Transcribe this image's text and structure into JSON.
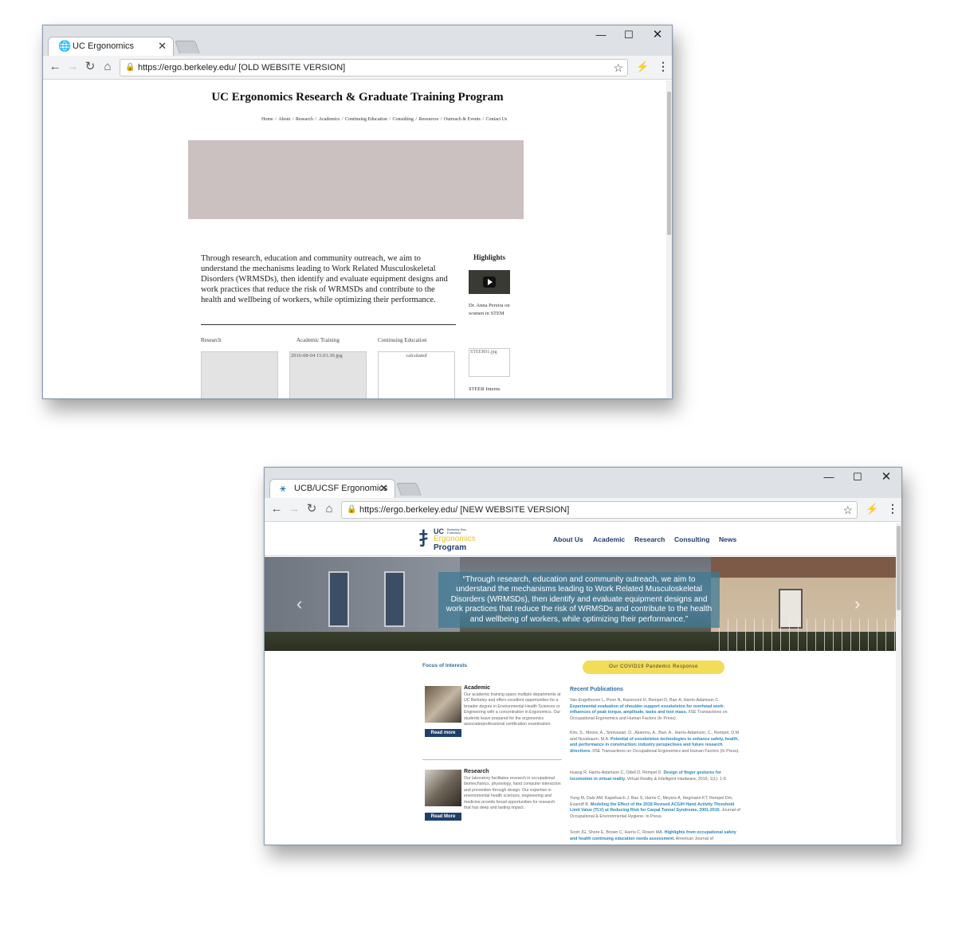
{
  "window_old": {
    "tab_title": "UC Ergonomics",
    "address": "https://ergo.berkeley.edu/ [OLD WEBSITE VERSION]",
    "page": {
      "title": "UC Ergonomics Research & Graduate Training Program",
      "nav": [
        "Home",
        "About",
        "Research",
        "Academics",
        "Continuing Education",
        "Consulting",
        "Resources",
        "Outreach & Events",
        "Contact Us"
      ],
      "intro": "Through research, education and community outreach, we aim to understand the mechanisms leading to Work Related Musculoskeletal Disorders (WRMSDs), then identify and evaluate equipment designs and work practices that reduce the risk of WRMSDs and contribute to the health and wellbeing of workers, while optimizing their performance.",
      "highlights_title": "Highlights",
      "highlight_caption": "Dr. Anna Pereira on women in STEM",
      "columns": [
        "Research",
        "Academic Training",
        "Continuing Education"
      ],
      "img_alt_2": "2016-08-04 15.03.39.jpg",
      "img_alt_3": "calculated",
      "steer_alt": "STEER01.jpg",
      "steer_caption": "STEER Interns"
    }
  },
  "window_new": {
    "tab_title": "UCB/UCSF Ergonomics",
    "address": "https://ergo.berkeley.edu/ [NEW WEBSITE VERSION]",
    "page": {
      "logo": {
        "uc": "UC",
        "sub": "Berkeley San Francisco",
        "line2": "Ergonomics",
        "line3": "Program"
      },
      "nav": [
        "About Us",
        "Academic",
        "Research",
        "Consulting",
        "News"
      ],
      "hero_quote": "“Through research, education and community outreach, we aim to understand the mechanisms leading to Work Related Musculoskeletal Disorders (WRMSDs), then identify and evaluate equipment designs and work practices that reduce the risk of WRMSDs and contribute to the health and wellbeing of workers, while optimizing their performance.”",
      "focus_label": "Focus of Interests",
      "covid_button": "Our COVID19 Pandemic Response",
      "cards": [
        {
          "title": "Academic",
          "body": "Our academic training spans multiple departments at UC Berkeley and offers excellent opportunities for a broader degree in Environmental Health Sciences or Engineering with a concentration in Ergonomics. Our students leave prepared for the ergonomics associate/professional certification examination.",
          "button": "Read more"
        },
        {
          "title": "Research",
          "body": "Our laboratory facilitates research in occupational biomechanics, physiology, hand computer interaction and prevention through design. Our expertise in environmental health sciences, engineering and medicine provide broad opportunities for research that has deep and lasting impact.",
          "button": "Read More"
        }
      ],
      "publications_title": "Recent Publications",
      "publications": [
        {
          "authors": "Van Engelhoven L, Poon N, Kazerooni H, Rempel D, Barr A, Harris-Adamson C.",
          "title": "Experimental evaluation of shoulder-support exoskeleton for overhead work: influences of peak torque, amplitude, tasks and tool mass.",
          "source": "IISE Transactions on Occupational Ergonomics and Human Factors (In Press)."
        },
        {
          "authors": "Kim, S., Moore, A., Srinivasan, D., Akanmu, A., Barr, A., Harris-Adamson, C., Rempel, D.M. and Nussbaum, M.A.",
          "title": "Potential of exoskeleton technologies to enhance safety, health, and performance in construction: industry perspectives and future research directions.",
          "source": "IISE Transactions on Occupational Ergonomics and Human Factors (In Press)."
        },
        {
          "authors": "Huang R, Harris-Adamson C, Odell D, Rempel D.",
          "title": "Design of finger gestures for locomotion in virtual reality.",
          "source": "Virtual Reality & Intelligent Hardware, 2019, 1(1): 1-9."
        },
        {
          "authors": "Yung M, Dale AM, Kapellusch J, Bao S, Harris C, Meyers A, Hegmann KT, Rempel Dm, Evanoff B.",
          "title": "Modeling the Effect of the 2018 Revised ACGIH Hand Activity Threshold Limit Value (TLV) at Reducing Risk for Carpal Tunnel Syndrome, 2001-2010.",
          "source": "Journal of Occupational & Environmental Hygiene. In Press."
        },
        {
          "authors": "Scott JG, Shore E, Brown C, Harris C, Rosen MA.",
          "title": "Highlights from occupational safety and health continuing education needs assessment.",
          "source": "American Journal of"
        }
      ]
    }
  }
}
